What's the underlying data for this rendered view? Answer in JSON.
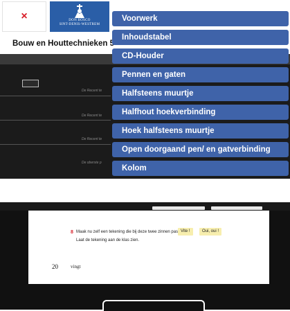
{
  "header": {
    "close_glyph": "×",
    "logo_line1": "DON BOSCO",
    "logo_line2": "SINT-DENIS-WESTREM"
  },
  "book": {
    "title": "Bouw en Houttechnieken 5"
  },
  "preview": {
    "box_label": "5",
    "snippets": [
      "De Recent te",
      "De Recent te",
      "De Recent te",
      "De oberste p"
    ]
  },
  "chapters": {
    "items": [
      "Voorwerk",
      "Inhoudstabel",
      "CD-Houder",
      "Pennen en gaten",
      "Halfsteens muurtje",
      "Halfhout hoekverbinding",
      "Hoek halfsteens muurtje",
      "Open doorgaand pen/ en gatverbinding",
      "Kolom"
    ]
  },
  "lower_page": {
    "exercise_number": "8",
    "exercise_line1": "Maak nu zelf een tekening die bij deze twee zinnen past:",
    "exercise_line2": "Laat de tekening aan de klas zien.",
    "chip1": "Vite !",
    "chip2": "Oui, oui !",
    "page_number": "20",
    "word": "vingt"
  },
  "colors": {
    "menu_item_bg": "#3f63a9",
    "logo_blue": "#2a5ea7",
    "close_red": "#d8202a",
    "highlight_chip": "#f7eeae"
  }
}
